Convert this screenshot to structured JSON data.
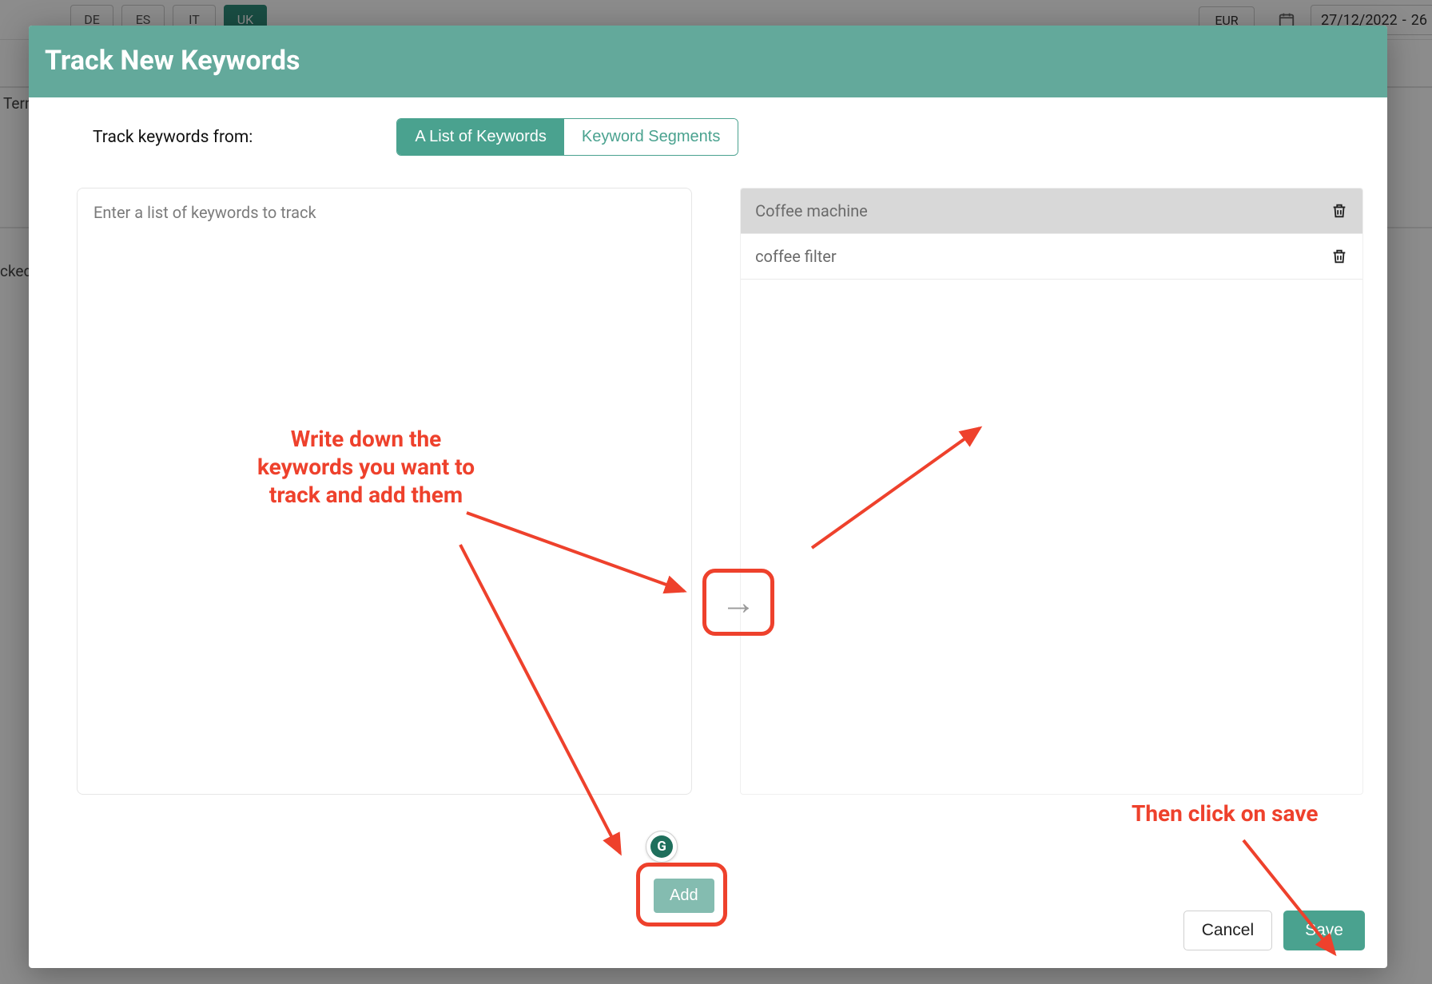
{
  "background": {
    "lang_buttons": [
      "DE",
      "ES",
      "IT",
      "UK"
    ],
    "active_lang_index": 3,
    "currency": "EUR",
    "date_range": {
      "from": "27/12/2022",
      "sep": "-",
      "to": "26"
    },
    "sidebar_label_terms": "Terms",
    "sidebar_label_tracked": "cked"
  },
  "modal": {
    "title": "Track New Keywords",
    "track_from_label": "Track keywords from:",
    "tabs": {
      "list": "A List of Keywords",
      "segments": "Keyword Segments"
    },
    "textarea_placeholder": "Enter a list of keywords to track",
    "add_button": "Add",
    "grammarly_letter": "G",
    "keyword_rows": [
      {
        "text": "Coffee machine",
        "highlighted": true
      },
      {
        "text": "coffee filter",
        "highlighted": false
      }
    ],
    "arrow_glyph": "→",
    "cancel": "Cancel",
    "save": "Save"
  },
  "annotations": {
    "left_text": "Write down the keywords you want to track and add them",
    "right_text": "Then click on save"
  }
}
